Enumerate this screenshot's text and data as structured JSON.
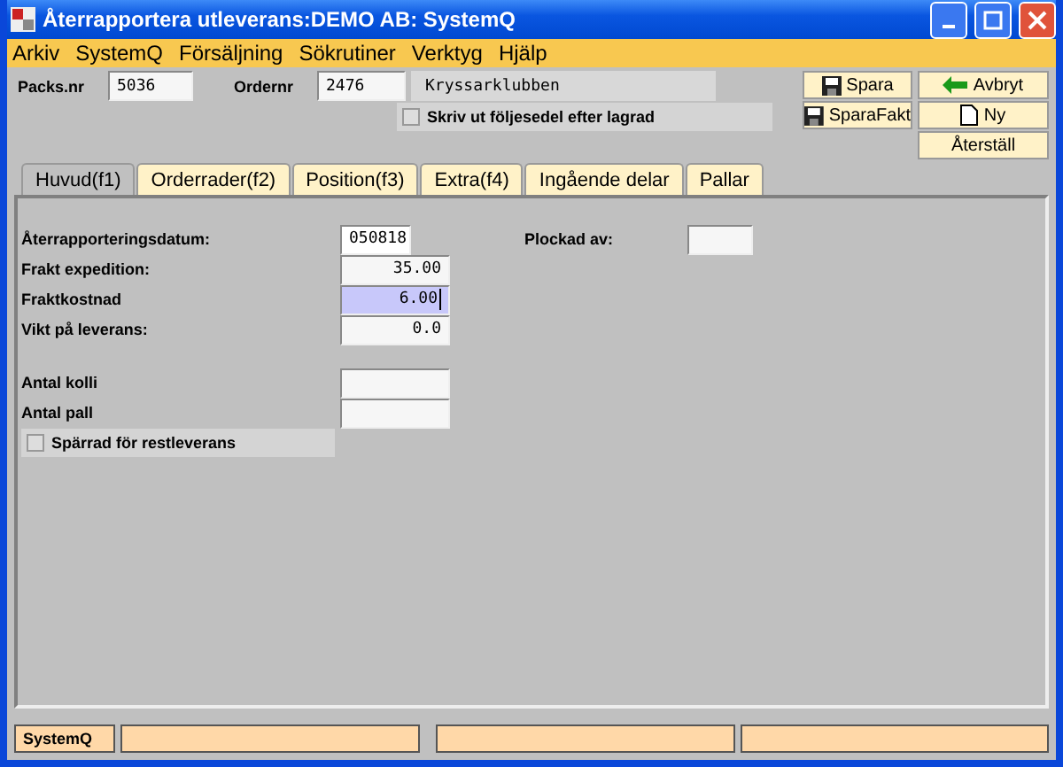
{
  "window": {
    "title": "Återrapportera utleverans:DEMO AB: SystemQ"
  },
  "menu": [
    "Arkiv",
    "SystemQ",
    "Försäljning",
    "Sökrutiner",
    "Verktyg",
    "Hjälp"
  ],
  "header": {
    "packs_label": "Packs.nr",
    "packs_value": "5036",
    "order_label": "Ordernr",
    "order_value": "2476",
    "customer": "Kryssarklubben",
    "print_checkbox": {
      "label": "Skriv ut följesedel efter lagrad",
      "checked": false
    }
  },
  "buttons": [
    {
      "label": "Spara",
      "kind": "save"
    },
    {
      "label": "Avbryt",
      "kind": "cancel"
    },
    {
      "label": "SparaFakt",
      "kind": "save"
    },
    {
      "label": "Ny",
      "kind": "new"
    },
    {
      "label": "Återställ",
      "kind": "reset"
    }
  ],
  "tabs": [
    {
      "label": "Huvud(f1)",
      "selected": true
    },
    {
      "label": "Orderrader(f2)",
      "selected": false
    },
    {
      "label": "Position(f3)",
      "selected": false
    },
    {
      "label": "Extra(f4)",
      "selected": false
    },
    {
      "label": "Ingående delar",
      "selected": false
    },
    {
      "label": "Pallar",
      "selected": false
    }
  ],
  "form": {
    "date_label": "Återrapporteringsdatum:",
    "date_value": "050818",
    "picked_label": "Plockad av:",
    "fields": [
      {
        "label": "Frakt  expedition:",
        "value": "35.00",
        "focused": false
      },
      {
        "label": "Fraktkostnad",
        "value": "6.00",
        "focused": true
      },
      {
        "label": "Vikt på leverans:",
        "value": "0.0",
        "focused": false
      }
    ],
    "counts": [
      {
        "label": "Antal kolli"
      },
      {
        "label": "Antal pall"
      }
    ],
    "restrict_checkbox": {
      "label": "Spärrad för restleverans",
      "checked": false
    }
  },
  "status_bar": {
    "text": "SystemQ"
  }
}
